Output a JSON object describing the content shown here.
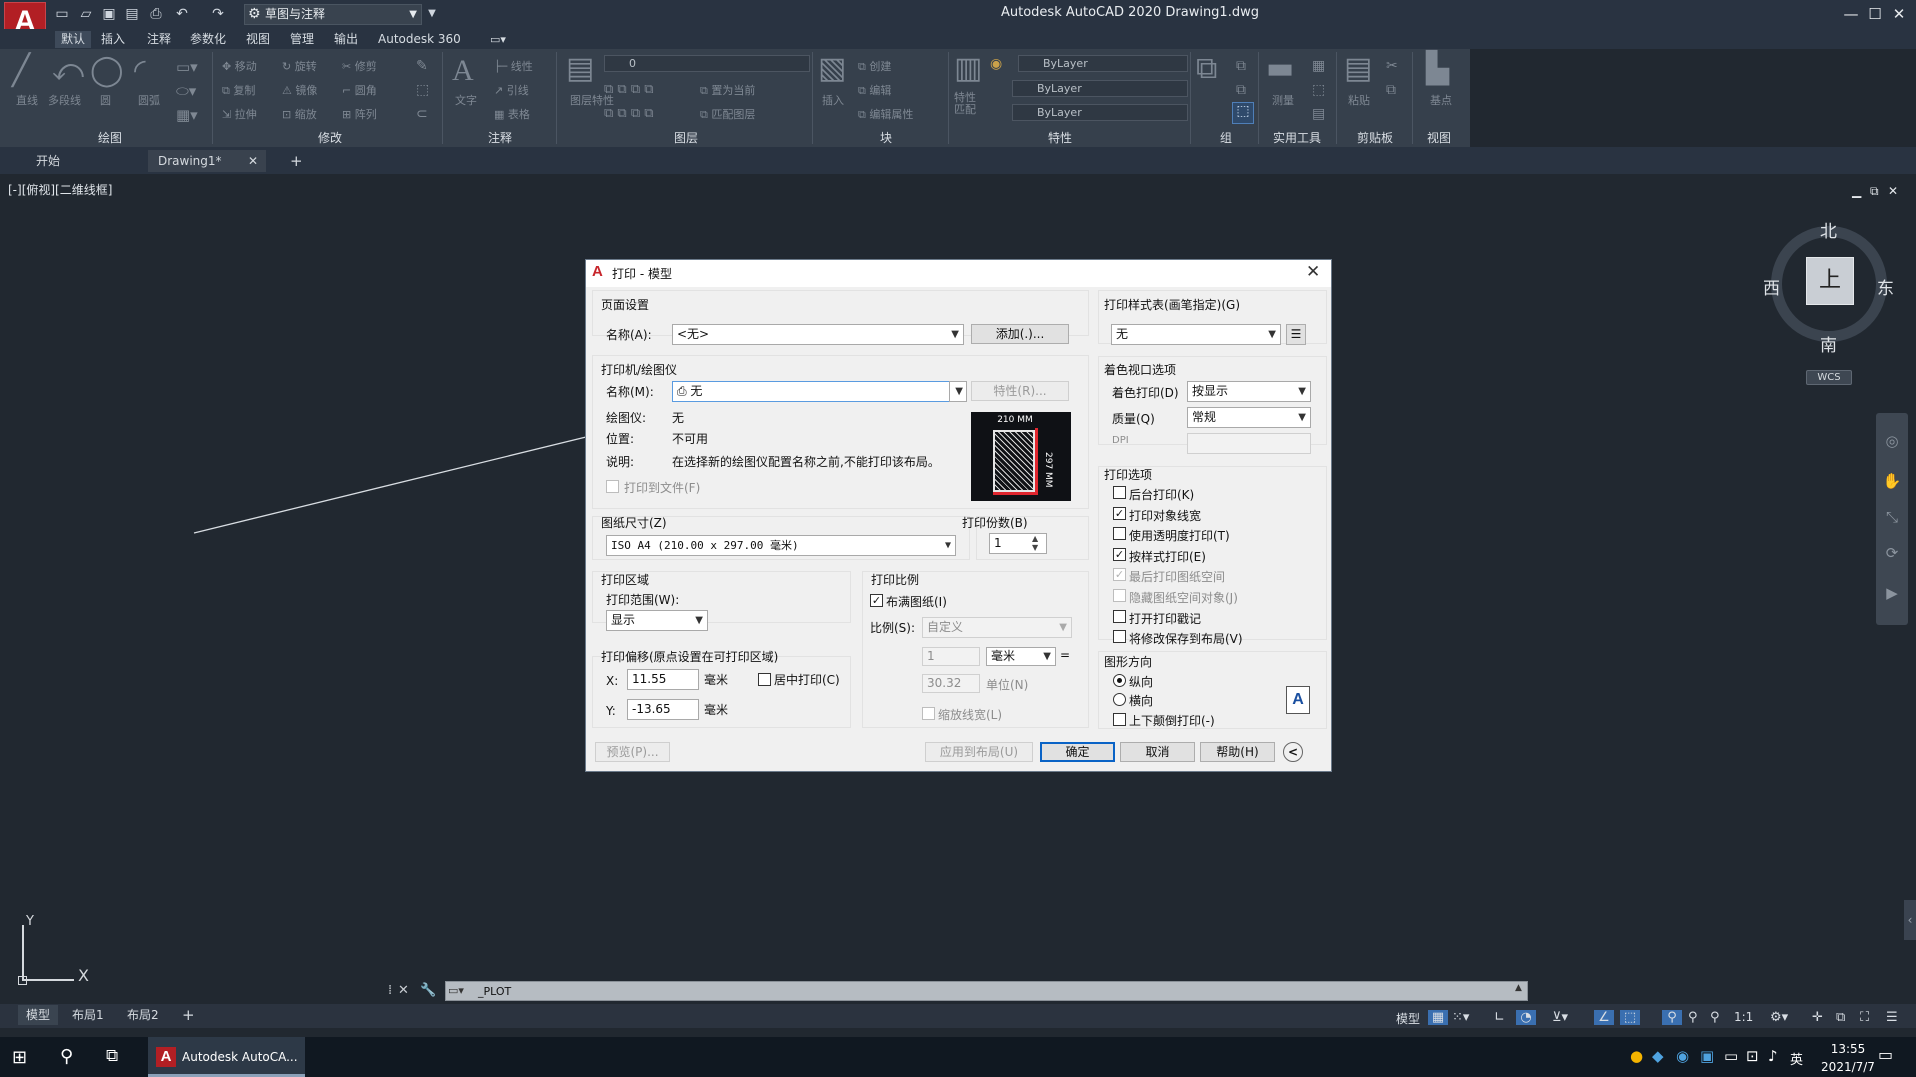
{
  "app": {
    "title": "Autodesk AutoCAD 2020    Drawing1.dwg",
    "logo": "A",
    "workspace": "草图与注释",
    "colors": {
      "background": "#212830",
      "ribbon": "#36404c",
      "accent": "#0a63c6",
      "logo": "#b21f24"
    }
  },
  "menu": [
    "默认",
    "插入",
    "注释",
    "参数化",
    "视图",
    "管理",
    "输出",
    "Autodesk 360"
  ],
  "ribbon": {
    "panels": [
      "绘图",
      "修改",
      "注释",
      "图层",
      "块",
      "特性",
      "组",
      "实用工具",
      "剪贴板",
      "视图"
    ],
    "draw_tools": [
      "直线",
      "多段线",
      "圆",
      "圆弧"
    ],
    "modify_tools": [
      "移动",
      "旋转",
      "修剪",
      "复制",
      "镜像",
      "圆角",
      "拉伸",
      "缩放",
      "阵列"
    ],
    "annotation_tools": [
      "文字",
      "线性",
      "引线",
      "表格"
    ],
    "layer_tools": [
      "图层特性",
      "置为当前",
      "匹配图层"
    ],
    "layer_value": "0",
    "block_tools": [
      "插入",
      "创建",
      "编辑",
      "编辑属性"
    ],
    "properties_tools": [
      "特性匹配"
    ],
    "properties_values": [
      "ByLayer",
      "ByLayer",
      "ByLayer"
    ],
    "utility_tools": [
      "测量"
    ],
    "clipboard_tools": [
      "粘贴"
    ],
    "view_tools": [
      "基点"
    ]
  },
  "doc_tabs": [
    "开始",
    "Drawing1*"
  ],
  "viewport": {
    "label": "[-][俯视][二维线框]",
    "compass": {
      "north": "北",
      "south": "南",
      "east": "东",
      "west": "西",
      "top": "上"
    },
    "wcs": "WCS"
  },
  "ucs": {
    "x": "X",
    "y": "Y"
  },
  "command": {
    "text": "_PLOT"
  },
  "layout_tabs": [
    "模型",
    "布局1",
    "布局2"
  ],
  "status": {
    "model": "模型",
    "scale": "1:1"
  },
  "taskbar": {
    "app": "Autodesk AutoCA...",
    "time": "13:55",
    "date": "2021/7/7",
    "ime": "英"
  },
  "dialog": {
    "title": "打印 - 模型",
    "page_setup": {
      "group": "页面设置",
      "name_label": "名称(A):",
      "name_value": "<无>",
      "add_button": "添加(.)..."
    },
    "printer": {
      "group": "打印机/绘图仪",
      "name_label": "名称(M):",
      "name_value": "无",
      "properties_button": "特性(R)...",
      "plotter_label": "绘图仪:",
      "plotter_value": "无",
      "location_label": "位置:",
      "location_value": "不可用",
      "description_label": "说明:",
      "description_value": "在选择新的绘图仪配置名称之前,不能打印该布局。",
      "plot_to_file": "打印到文件(F)",
      "preview_width": "210 MM",
      "preview_height": "297 MM"
    },
    "paper_size": {
      "group": "图纸尺寸(Z)",
      "value": "ISO A4 (210.00 x 297.00 毫米)"
    },
    "copies": {
      "group": "打印份数(B)",
      "value": "1"
    },
    "plot_area": {
      "group": "打印区域",
      "range_label": "打印范围(W):",
      "range_value": "显示"
    },
    "plot_offset": {
      "group": "打印偏移(原点设置在可打印区域)",
      "x_label": "X:",
      "x_value": "11.55",
      "x_unit": "毫米",
      "y_label": "Y:",
      "y_value": "-13.65",
      "y_unit": "毫米",
      "center": "居中打印(C)"
    },
    "plot_scale": {
      "group": "打印比例",
      "fit": "布满图纸(I)",
      "scale_label": "比例(S):",
      "scale_value": "自定义",
      "value1": "1",
      "unit": "毫米",
      "equals": "=",
      "value2": "30.32",
      "unit2": "单位(N)",
      "lineweights": "缩放线宽(L)"
    },
    "style_table": {
      "group": "打印样式表(画笔指定)(G)",
      "value": "无"
    },
    "shaded": {
      "group": "着色视口选项",
      "shade_label": "着色打印(D)",
      "shade_value": "按显示",
      "quality_label": "质量(Q)",
      "quality_value": "常规",
      "dpi_label": "DPI"
    },
    "options": {
      "group": "打印选项",
      "items": [
        {
          "label": "后台打印(K)",
          "checked": false,
          "disabled": false
        },
        {
          "label": "打印对象线宽",
          "checked": true,
          "disabled": false
        },
        {
          "label": "使用透明度打印(T)",
          "checked": false,
          "disabled": false
        },
        {
          "label": "按样式打印(E)",
          "checked": true,
          "disabled": false
        },
        {
          "label": "最后打印图纸空间",
          "checked": true,
          "disabled": true
        },
        {
          "label": "隐藏图纸空间对象(J)",
          "checked": false,
          "disabled": true
        },
        {
          "label": "打开打印戳记",
          "checked": false,
          "disabled": false
        },
        {
          "label": "将修改保存到布局(V)",
          "checked": false,
          "disabled": false
        }
      ]
    },
    "orientation": {
      "group": "图形方向",
      "portrait": "纵向",
      "landscape": "横向",
      "upside_down": "上下颠倒打印(-)",
      "icon": "A"
    },
    "buttons": {
      "preview": "预览(P)...",
      "apply": "应用到布局(U)",
      "ok": "确定",
      "cancel": "取消",
      "help": "帮助(H)",
      "more": "<"
    }
  }
}
